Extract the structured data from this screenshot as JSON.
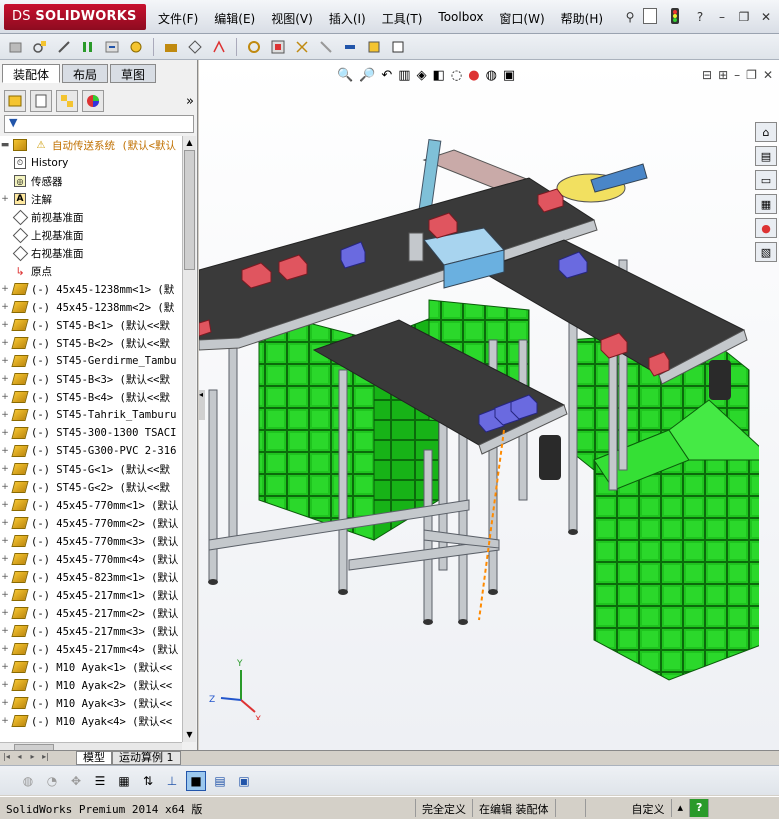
{
  "app": {
    "logo_prefix": "DS",
    "logo_text": "SOLIDWORKS"
  },
  "menu": [
    "文件(F)",
    "编辑(E)",
    "视图(V)",
    "插入(I)",
    "工具(T)",
    "Toolbox",
    "窗口(W)",
    "帮助(H)"
  ],
  "title_controls": {
    "help": "?",
    "minimize": "–",
    "restore": "❐",
    "close": "✕"
  },
  "panel": {
    "tabs": [
      "装配体",
      "布局",
      "草图"
    ],
    "expand_glyph": "»"
  },
  "tree": {
    "root": "自动传送系统  (默认<默认",
    "items": [
      {
        "label": "History",
        "icon": "history-icon",
        "kind": "special"
      },
      {
        "label": "传感器",
        "icon": "sensor-icon",
        "kind": "special"
      },
      {
        "label": "注解",
        "icon": "annotation-icon",
        "kind": "expandable"
      },
      {
        "label": "前视基准面",
        "icon": "plane-icon",
        "kind": "plane"
      },
      {
        "label": "上视基准面",
        "icon": "plane-icon",
        "kind": "plane"
      },
      {
        "label": "右视基准面",
        "icon": "plane-icon",
        "kind": "plane"
      },
      {
        "label": "原点",
        "icon": "origin-icon",
        "kind": "origin"
      },
      {
        "label": "(-) 45x45-1238mm<1>  (默",
        "icon": "part-icon",
        "kind": "part"
      },
      {
        "label": "(-) 45x45-1238mm<2>  (默",
        "icon": "part-icon",
        "kind": "part"
      },
      {
        "label": "(-) ST45-B<1>  (默认<<默",
        "icon": "part-icon",
        "kind": "part"
      },
      {
        "label": "(-) ST45-B<2>  (默认<<默",
        "icon": "part-icon",
        "kind": "part"
      },
      {
        "label": "(-) ST45-Gerdirme_Tambu",
        "icon": "part-icon",
        "kind": "part"
      },
      {
        "label": "(-) ST45-B<3>  (默认<<默",
        "icon": "part-icon",
        "kind": "part"
      },
      {
        "label": "(-) ST45-B<4>  (默认<<默",
        "icon": "part-icon",
        "kind": "part"
      },
      {
        "label": "(-) ST45-Tahrik_Tamburu",
        "icon": "part-icon",
        "kind": "part"
      },
      {
        "label": "(-) ST45-300-1300 TSACI",
        "icon": "part-icon",
        "kind": "part"
      },
      {
        "label": "(-) ST45-G300-PVC 2-316",
        "icon": "part-icon",
        "kind": "part"
      },
      {
        "label": "(-) ST45-G<1>  (默认<<默",
        "icon": "part-icon",
        "kind": "part"
      },
      {
        "label": "(-) ST45-G<2>  (默认<<默",
        "icon": "part-icon",
        "kind": "part"
      },
      {
        "label": "(-) 45x45-770mm<1>  (默认",
        "icon": "part-icon",
        "kind": "part"
      },
      {
        "label": "(-) 45x45-770mm<2>  (默认",
        "icon": "part-icon",
        "kind": "part"
      },
      {
        "label": "(-) 45x45-770mm<3>  (默认",
        "icon": "part-icon",
        "kind": "part"
      },
      {
        "label": "(-) 45x45-770mm<4>  (默认",
        "icon": "part-icon",
        "kind": "part"
      },
      {
        "label": "(-) 45x45-823mm<1>  (默认",
        "icon": "part-icon",
        "kind": "part"
      },
      {
        "label": "(-) 45x45-217mm<1>  (默认",
        "icon": "part-icon",
        "kind": "part"
      },
      {
        "label": "(-) 45x45-217mm<2>  (默认",
        "icon": "part-icon",
        "kind": "part"
      },
      {
        "label": "(-) 45x45-217mm<3>  (默认",
        "icon": "part-icon",
        "kind": "part"
      },
      {
        "label": "(-) 45x45-217mm<4>  (默认",
        "icon": "part-icon",
        "kind": "part"
      },
      {
        "label": "(-) M10 Ayak<1>  (默认<<",
        "icon": "part-icon",
        "kind": "part"
      },
      {
        "label": "(-) M10 Ayak<2>  (默认<<",
        "icon": "part-icon",
        "kind": "part"
      },
      {
        "label": "(-) M10 Ayak<3>  (默认<<",
        "icon": "part-icon",
        "kind": "part"
      },
      {
        "label": "(-) M10 Ayak<4>  (默认<<",
        "icon": "part-icon",
        "kind": "part"
      }
    ]
  },
  "bottom_tabs": [
    "模型",
    "运动算例 1"
  ],
  "triad": {
    "x": "X",
    "y": "Y",
    "z": "Z"
  },
  "status": {
    "product": "SolidWorks Premium 2014 x64 版",
    "definition": "完全定义",
    "editing": "在编辑 装配体",
    "units": "自定义",
    "help": "?"
  },
  "colors": {
    "bin_green": "#1fc41f",
    "belt_dark": "#3a3a3a",
    "frame_gray": "#c4c8cc",
    "box_red": "#e0555f",
    "box_blue": "#6a6ae0",
    "logo_red": "#c8102e"
  }
}
